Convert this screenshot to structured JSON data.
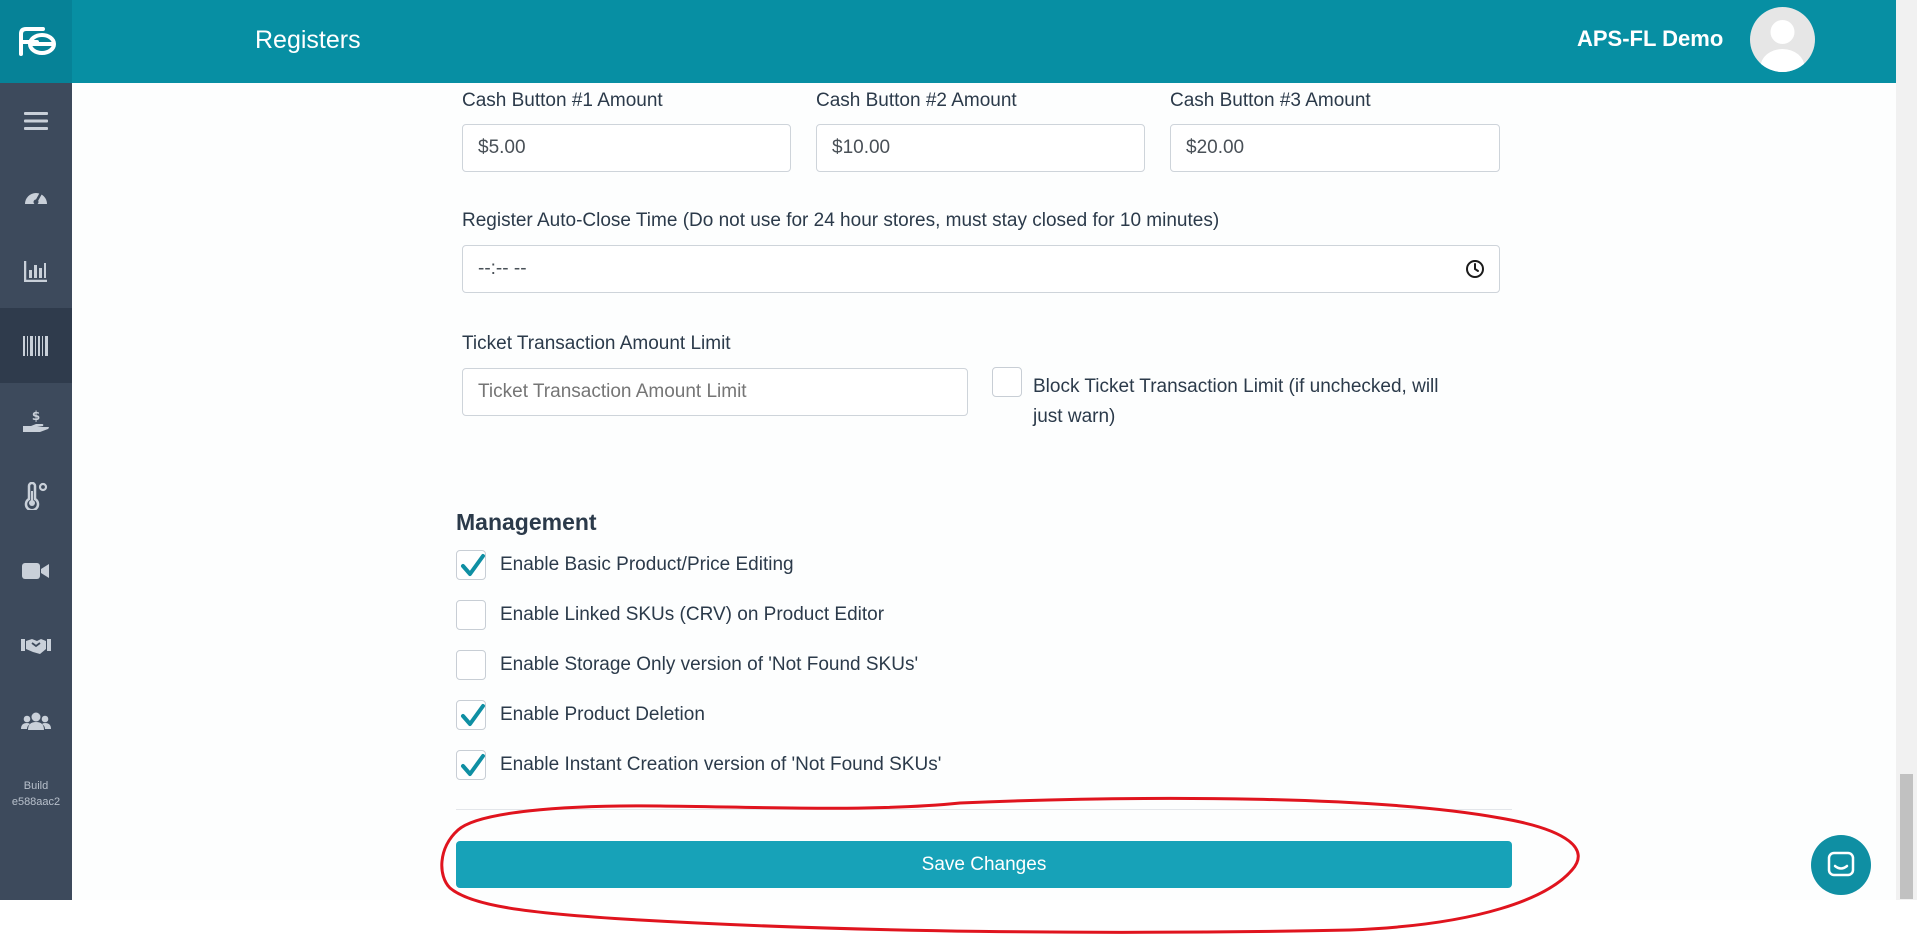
{
  "header": {
    "title": "Registers",
    "org_name": "APS-FL Demo"
  },
  "sidebar": {
    "items": [
      {
        "icon": "menu-icon"
      },
      {
        "icon": "dashboard-gauge-icon"
      },
      {
        "icon": "bar-chart-icon"
      },
      {
        "icon": "barcode-icon",
        "active": true
      },
      {
        "icon": "hand-dollar-icon"
      },
      {
        "icon": "temperature-icon"
      },
      {
        "icon": "video-camera-icon"
      },
      {
        "icon": "handshake-icon"
      },
      {
        "icon": "users-icon"
      }
    ],
    "build_label": "Build",
    "build_id": "e588aac2"
  },
  "form": {
    "cash1": {
      "label": "Cash Button #1 Amount",
      "value": "$5.00"
    },
    "cash2": {
      "label": "Cash Button #2 Amount",
      "value": "$10.00"
    },
    "cash3": {
      "label": "Cash Button #3 Amount",
      "value": "$20.00"
    },
    "auto_close": {
      "label": "Register Auto-Close Time (Do not use for 24 hour stores, must stay closed for 10 minutes)",
      "value": "--:-- --"
    },
    "ticket_limit": {
      "label": "Ticket Transaction Amount Limit",
      "placeholder": "Ticket Transaction Amount Limit",
      "value": ""
    },
    "block_limit": {
      "label_line1": "Block Ticket Transaction Limit (if unchecked, will",
      "label_line2": "just warn)",
      "checked": false
    }
  },
  "management": {
    "title": "Management",
    "options": [
      {
        "label": "Enable Basic Product/Price Editing",
        "checked": true
      },
      {
        "label": "Enable Linked SKUs (CRV) on Product Editor",
        "checked": false
      },
      {
        "label": "Enable Storage Only version of 'Not Found SKUs'",
        "checked": false
      },
      {
        "label": "Enable Product Deletion",
        "checked": true
      },
      {
        "label": "Enable Instant Creation version of 'Not Found SKUs'",
        "checked": true
      }
    ]
  },
  "actions": {
    "save_label": "Save Changes"
  },
  "colors": {
    "header": "#078fa3",
    "sidebar": "#3d4a5c",
    "primary_button": "#17a2b8",
    "check_mark": "#0f8fa3",
    "annotation": "#e0141e"
  }
}
